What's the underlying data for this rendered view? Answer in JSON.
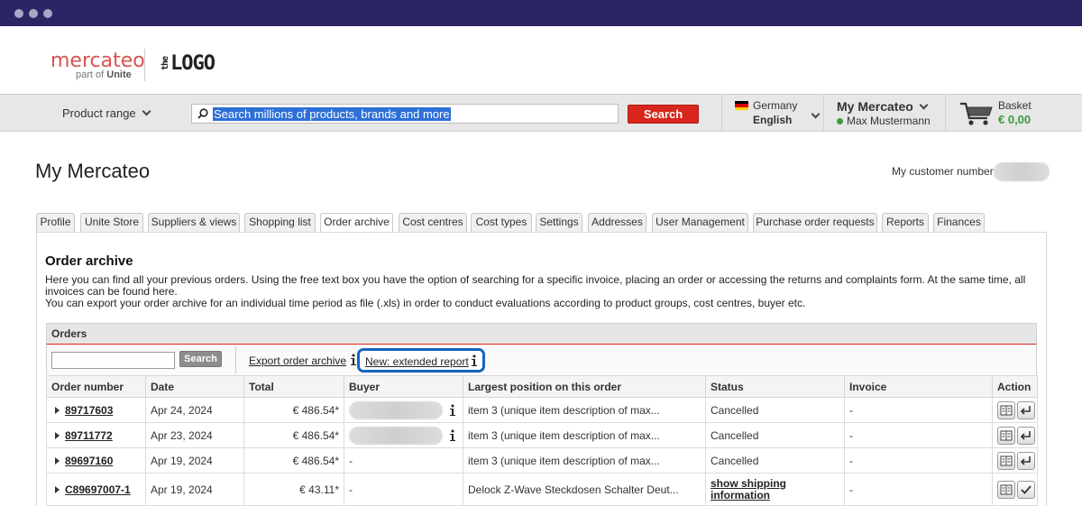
{
  "brand": {
    "name": "mercateo",
    "sub_prefix": "part of ",
    "sub_bold": "Unite",
    "partner_logo": "LOGO",
    "partner_prefix": "the",
    "accent": "#d9534f"
  },
  "nav": {
    "product_range": "Product range",
    "search_placeholder": "Search millions of products, brands and more",
    "search_button": "Search",
    "country": "Germany",
    "language": "English",
    "my_title": "My Mercateo",
    "user": "Max Mustermann",
    "basket_label": "Basket",
    "basket_amount": "€ 0,00"
  },
  "page": {
    "title": "My Mercateo",
    "customer_number_label": "My customer number:"
  },
  "tabs": [
    "Profile",
    "Unite Store",
    "Suppliers & views",
    "Shopping list",
    "Order archive",
    "Cost centres",
    "Cost types",
    "Settings",
    "Addresses",
    "User Management",
    "Purchase order requests",
    "Reports",
    "Finances"
  ],
  "active_tab": "Order archive",
  "archive": {
    "title": "Order archive",
    "desc1": "Here you can find all your previous orders. Using the free text box you have the option of searching for a specific invoice, placing an order or accessing the returns and complaints form. At the same time, all invoices can be found here.",
    "desc2": "You can export your order archive for an individual time period as file (.xls) in order to conduct evaluations according to product groups, cost centres, buyer etc.",
    "orders_label": "Orders",
    "filter_button": "Search",
    "export_link": "Export order archive",
    "extended_link": "New: extended report"
  },
  "table": {
    "headers": [
      "Order number",
      "Date",
      "Total",
      "Buyer",
      "Largest position on this order",
      "Status",
      "Invoice",
      "Action"
    ],
    "rows": [
      {
        "order": "89717603",
        "date": "Apr 24, 2024",
        "total": "€ 486.54*",
        "buyer": "",
        "position": "item 3 (unique item description of max...",
        "status": "Cancelled",
        "invoice": "-"
      },
      {
        "order": "89711772",
        "date": "Apr 23, 2024",
        "total": "€ 486.54*",
        "buyer": "",
        "position": "item 3 (unique item description of max...",
        "status": "Cancelled",
        "invoice": "-"
      },
      {
        "order": "89697160",
        "date": "Apr 19, 2024",
        "total": "€ 486.54*",
        "buyer": "-",
        "position": "item 3 (unique item description of max...",
        "status": "Cancelled",
        "invoice": "-"
      },
      {
        "order": "C89697007-1",
        "date": "Apr 19, 2024",
        "total": "€ 43.11*",
        "buyer": "-",
        "position": "Delock Z-Wave Steckdosen Schalter Deut...",
        "status": "show shipping information",
        "invoice": "-"
      }
    ]
  },
  "colors": {
    "titlebar": "#2b2566",
    "search_button": "#d8261c",
    "cancelled": "#d8261c",
    "highlight_border": "#1565c0"
  }
}
